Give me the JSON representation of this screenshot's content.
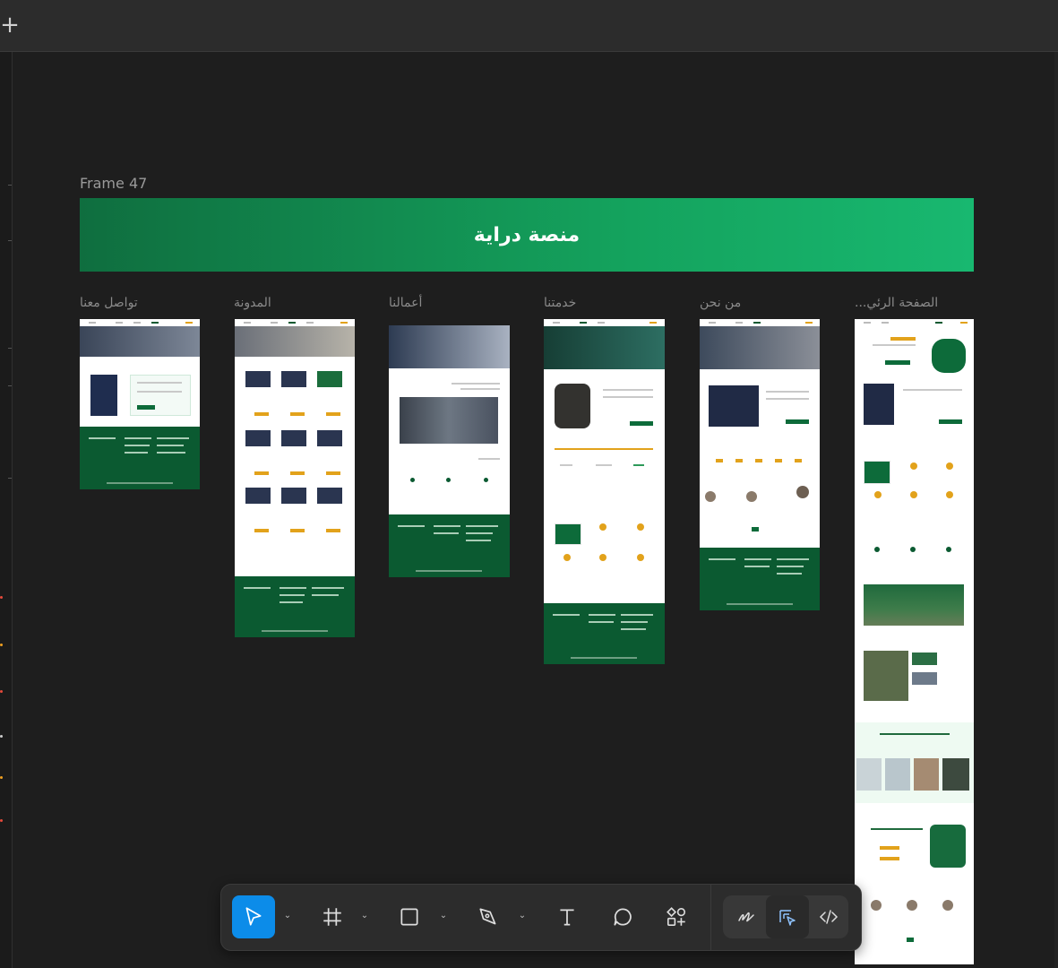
{
  "canvas": {
    "frame_name": "Frame 47",
    "banner_title": "منصة دراية",
    "pages": [
      {
        "label": "تواصل معنا"
      },
      {
        "label": "المدونة"
      },
      {
        "label": "أعمالنا"
      },
      {
        "label": "خدمتنا"
      },
      {
        "label": "من نحن"
      },
      {
        "label": "الصفحة الرئي..."
      }
    ]
  },
  "toolbar": {
    "tools": [
      {
        "name": "move-tool",
        "icon": "cursor-arrow-icon",
        "active": true
      },
      {
        "name": "frame-tool",
        "icon": "hash-frame-icon"
      },
      {
        "name": "rectangle-tool",
        "icon": "square-icon"
      },
      {
        "name": "pen-tool",
        "icon": "pen-nib-icon"
      },
      {
        "name": "text-tool",
        "icon": "text-t-icon"
      },
      {
        "name": "comment-tool",
        "icon": "speech-bubble-icon"
      },
      {
        "name": "components-tool",
        "icon": "shapes-plus-icon"
      }
    ],
    "modes": [
      {
        "name": "draw-mode",
        "icon": "scribble-icon"
      },
      {
        "name": "design-mode",
        "icon": "design-pointer-icon",
        "active": true
      },
      {
        "name": "dev-mode",
        "icon": "code-brackets-icon"
      }
    ]
  },
  "colors": {
    "canvas": "#1e1e1e",
    "brand_green": "#0b5a31",
    "banner_green": "#18b870",
    "accent_gold": "#e2a21b",
    "selection_blue": "#0c8ce9"
  }
}
